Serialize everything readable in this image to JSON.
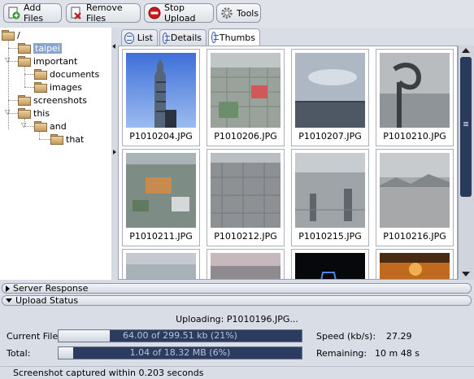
{
  "toolbar": {
    "add_files": "Add Files",
    "remove_files": "Remove Files",
    "stop_upload": "Stop Upload",
    "tools": "Tools"
  },
  "tree": {
    "root": "/",
    "taipei": "taipei",
    "important": "important",
    "documents": "documents",
    "images": "images",
    "screenshots": "screenshots",
    "this": "this",
    "and": "and",
    "that": "that"
  },
  "tabs": {
    "list": "List",
    "details": "Details",
    "thumbs": "Thumbs"
  },
  "thumbnails": [
    {
      "name": "P1010204.JPG"
    },
    {
      "name": "P1010206.JPG"
    },
    {
      "name": "P1010207.JPG"
    },
    {
      "name": "P1010210.JPG"
    },
    {
      "name": "P1010211.JPG"
    },
    {
      "name": "P1010212.JPG"
    },
    {
      "name": "P1010215.JPG"
    },
    {
      "name": "P1010216.JPG"
    }
  ],
  "sections": {
    "server_response": "Server Response",
    "upload_status": "Upload Status"
  },
  "upload": {
    "uploading_text": "Uploading: P1010196.JPG...",
    "current_file_label": "Current File:",
    "current_file_progress": "64.00 of 299.51 kb (21%)",
    "current_file_fraction": 0.21,
    "total_label": "Total:",
    "total_progress": "1.04 of 18.32 MB (6%)",
    "total_fraction": 0.06,
    "speed_label": "Speed (kb/s):",
    "speed_value": "27.29",
    "remaining_label": "Remaining:",
    "remaining_value": "10 m 48 s"
  },
  "statusbar": {
    "text": "Screenshot captured within 0.203 seconds"
  },
  "colors": {
    "selected_bg": "#8aa4d0",
    "progress_dark": "#2b3c60"
  }
}
